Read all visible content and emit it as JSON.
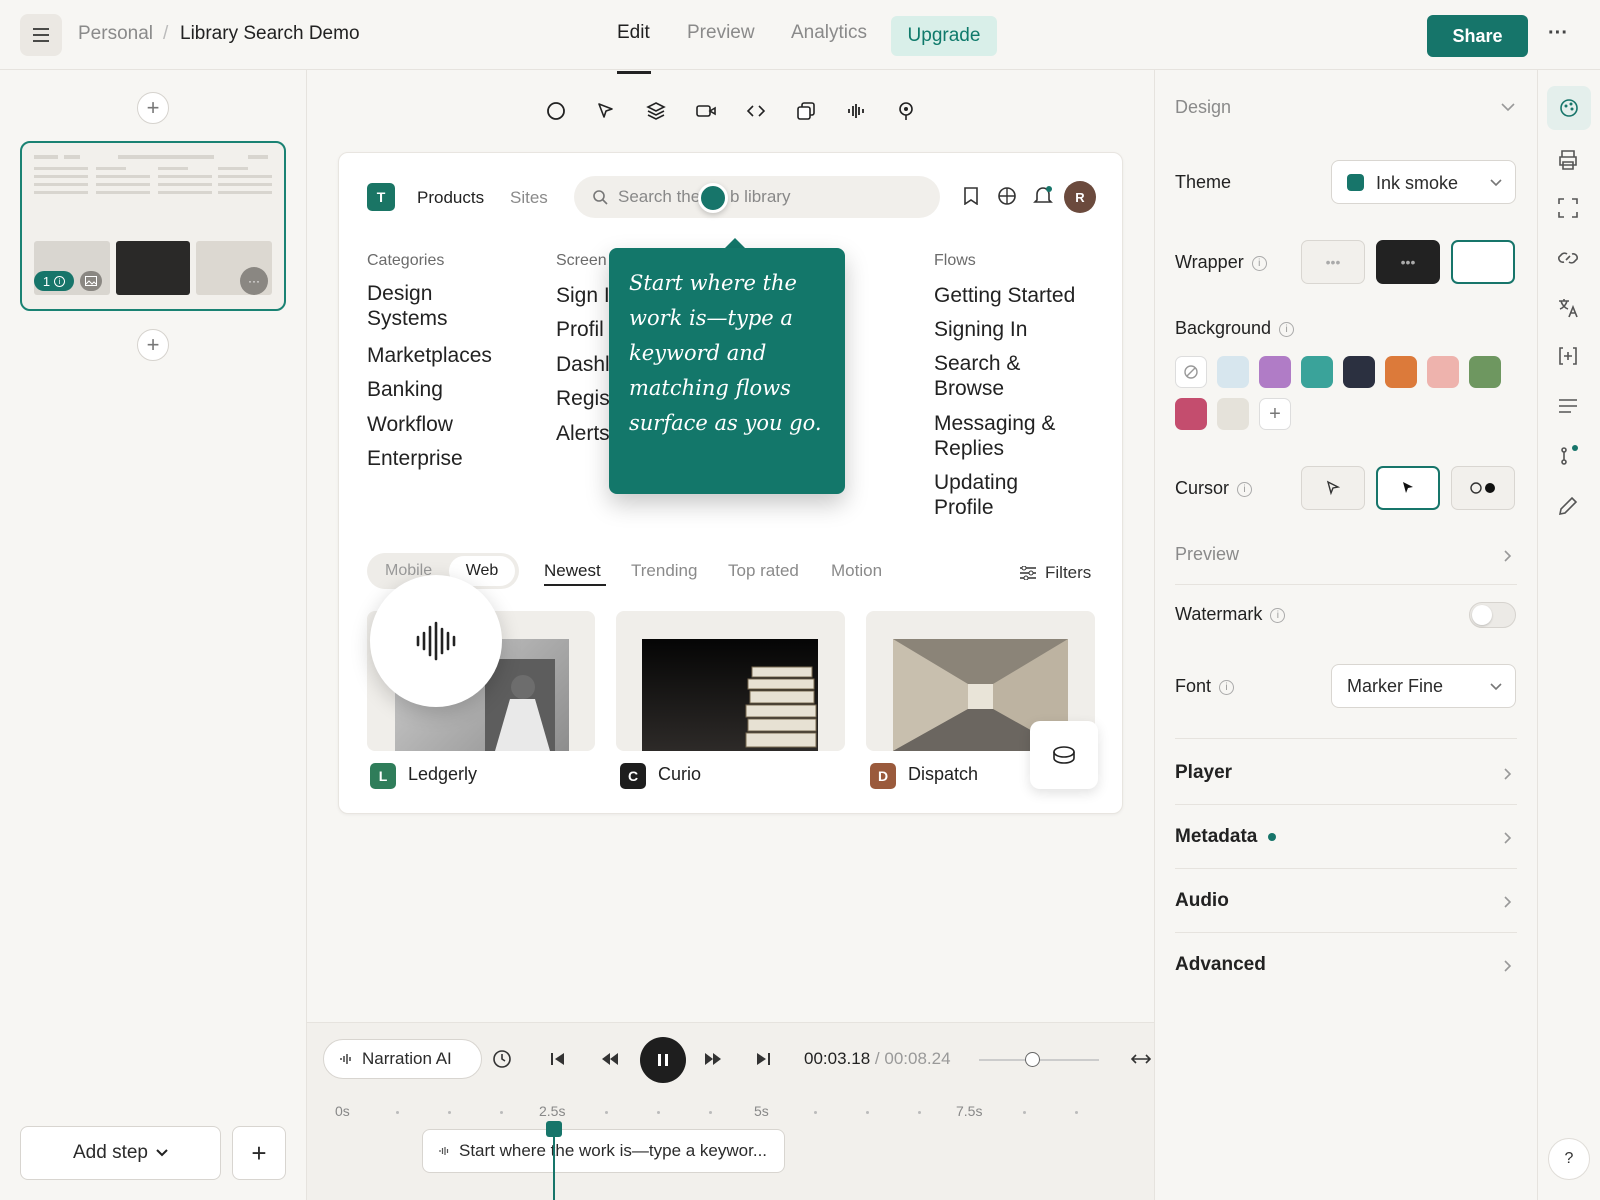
{
  "header": {
    "breadcrumb_parent": "Personal",
    "breadcrumb_sep": "/",
    "breadcrumb_current": "Library Search Demo",
    "tabs": [
      "Edit",
      "Preview",
      "Analytics"
    ],
    "upgrade_label": "Upgrade",
    "share_label": "Share",
    "more_label": "···"
  },
  "left_panel": {
    "thumb_badge": "1",
    "add_step_label": "Add step"
  },
  "canvas": {
    "logo_letter": "T",
    "nav_products": "Products",
    "nav_sites": "Sites",
    "search_placeholder_left": "Search the",
    "search_placeholder_right": "b library",
    "avatar_letter": "R",
    "columns": {
      "categories": {
        "heading": "Categories",
        "items": [
          "Design Systems",
          "Marketplaces",
          "Banking",
          "Workflow",
          "Enterprise"
        ]
      },
      "screens": {
        "heading": "Screen",
        "items": [
          "Sign I",
          "Profil",
          "Dashl",
          "Regis",
          "Alerts"
        ]
      },
      "flows": {
        "heading": "Flows",
        "items": [
          "Getting Started",
          "Signing In",
          "Search & Browse",
          "Messaging & Replies",
          "Updating Profile"
        ]
      }
    },
    "tooltip_text": "Start where the work is—type a keyword and matching flows surface as you go.",
    "segment": {
      "mobile": "Mobile",
      "web": "Web"
    },
    "sort_tabs": [
      "Newest",
      "Trending",
      "Top rated",
      "Motion"
    ],
    "filters_label": "Filters",
    "gallery": [
      {
        "letter": "L",
        "name": "Ledgerly",
        "color": "#2f7d5a"
      },
      {
        "letter": "C",
        "name": "Curio",
        "color": "#1e1e1e"
      },
      {
        "letter": "D",
        "name": "Dispatch",
        "color": "#9a5a3c"
      }
    ]
  },
  "right_panel": {
    "design_label": "Design",
    "theme_label": "Theme",
    "theme_value": "Ink smoke",
    "theme_color": "#17756a",
    "wrapper_label": "Wrapper",
    "background_label": "Background",
    "background_swatches": [
      "#d7e6ee",
      "#b07cc6",
      "#3aa39a",
      "#2b3040",
      "#dc7a3a",
      "#eeb3ad",
      "#6e9760",
      "#c44d6e",
      "#e5e2da"
    ],
    "cursor_label": "Cursor",
    "preview_label": "Preview",
    "watermark_label": "Watermark",
    "font_label": "Font",
    "font_value": "Marker Fine",
    "sections": [
      "Player",
      "Metadata",
      "Audio",
      "Advanced"
    ],
    "accent": "#17756a"
  },
  "player": {
    "narration_label": "Narration AI",
    "time_current": "00:03.18",
    "time_sep": " / ",
    "time_total": "00:08.24",
    "ticks": [
      "0s",
      "2.5s",
      "5s",
      "7.5s"
    ],
    "clip_text": "Start where the work is—type a keywor..."
  },
  "rail": {
    "help_label": "?"
  }
}
